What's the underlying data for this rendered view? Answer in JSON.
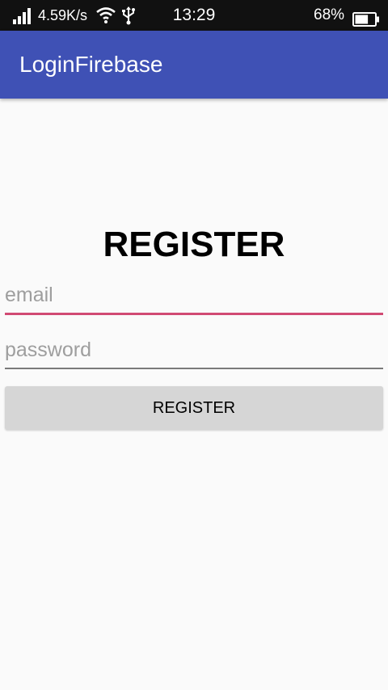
{
  "status_bar": {
    "net_speed": "4.59K/s",
    "time": "13:29",
    "battery": "68%",
    "icons": [
      "signal-icon",
      "wifi-icon",
      "usb-icon",
      "battery-icon"
    ],
    "battery_level": 0.68
  },
  "app_bar": {
    "title": "LoginFirebase",
    "color": "#3f51b5"
  },
  "form": {
    "heading": "REGISTER",
    "email_placeholder": "email",
    "email_value": "",
    "password_placeholder": "password",
    "password_value": "",
    "submit_label": "REGISTER",
    "focus_accent": "#d14a73"
  }
}
